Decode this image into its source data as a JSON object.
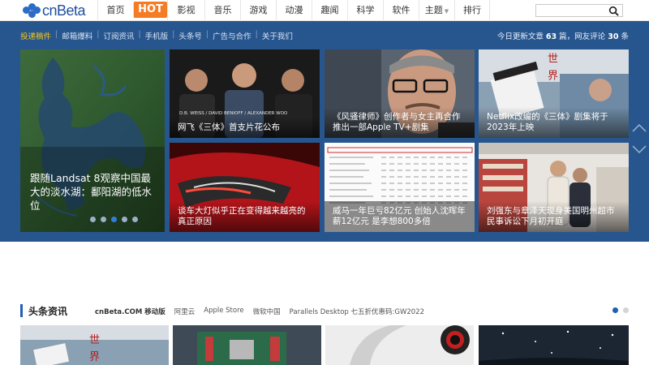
{
  "logo": {
    "text": "cnBeta"
  },
  "nav": {
    "items": [
      {
        "label": "首页"
      },
      {
        "label": "HOT",
        "hot": true
      },
      {
        "label": "影视"
      },
      {
        "label": "音乐"
      },
      {
        "label": "游戏"
      },
      {
        "label": "动漫"
      },
      {
        "label": "趣闻"
      },
      {
        "label": "科学"
      },
      {
        "label": "软件"
      },
      {
        "label": "主题",
        "dropdown": true
      },
      {
        "label": "排行"
      }
    ],
    "search_placeholder": ""
  },
  "subnav": {
    "links": [
      "投递稿件",
      "邮箱爆料",
      "订阅资讯",
      "手机版",
      "头条号",
      "广告与合作",
      "关于我们"
    ],
    "stats_prefix": "今日更新文章",
    "articles_count": "63",
    "stats_mid": "篇，网友评论",
    "comments_count": "30",
    "stats_suffix": "条"
  },
  "hero": {
    "feature": {
      "caption": "跟随Landsat 8观察中国最大的淡水湖：鄱阳湖的低水位",
      "active_dot": 2,
      "dot_count": 5
    },
    "tiles": [
      {
        "caption": "网飞《三体》首支片花公布",
        "overlay": "D.B. WEISS / DAVID BENIOFF / ALEXANDER WOO"
      },
      {
        "caption": "《风骚律师》创作者与女主再合作推出一部Apple TV+剧集"
      },
      {
        "caption": "Netflix改编的《三体》剧集将于2023年上映",
        "overlay": "世 界"
      },
      {
        "caption": "谈车大灯似乎正在变得越来越亮的真正原因"
      },
      {
        "caption": "威马一年巨亏82亿元 创始人沈晖年薪12亿元 是李想800多倍"
      },
      {
        "caption": "刘强东与章泽天现身美国明州超市 民事诉讼下月初开庭"
      }
    ]
  },
  "headlines": {
    "title": "头条资讯",
    "links": [
      "cnBeta.COM 移动版",
      "阿里云",
      "Apple Store",
      "微软中国",
      "Parallels Desktop 七五折优惠码:GW2022"
    ],
    "active_page": 0,
    "page_count": 2
  },
  "colors": {
    "brand_blue": "#27568f",
    "hot_orange": "#f57b25",
    "accent_yellow": "#f5c518"
  }
}
